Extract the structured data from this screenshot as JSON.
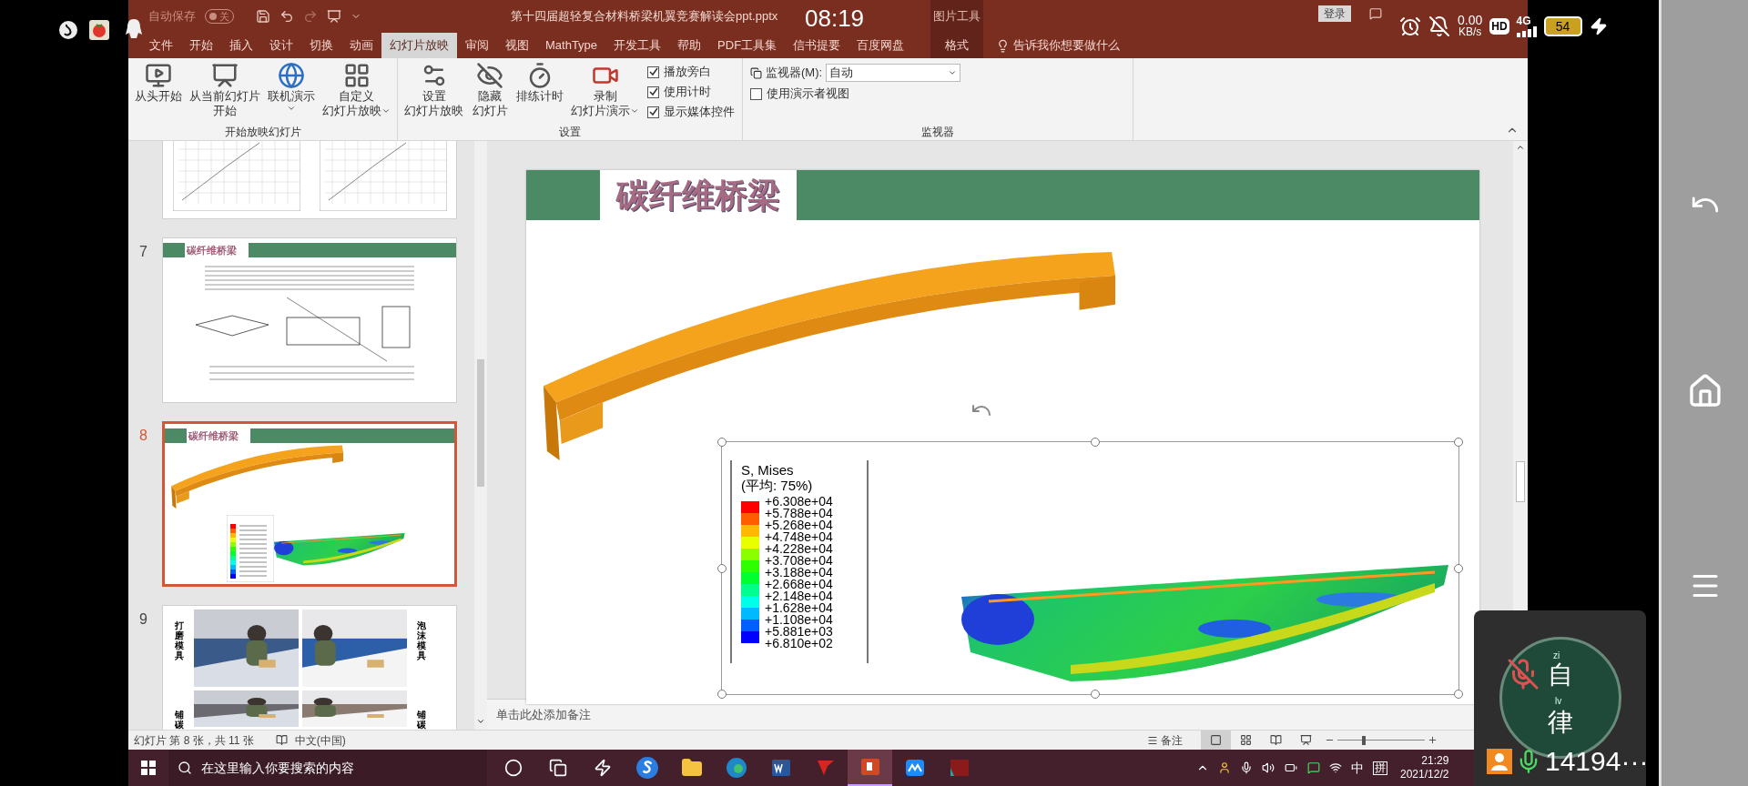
{
  "status_overlay": {
    "time": "08:19",
    "speed": "0.00",
    "speed_unit": "KB/s",
    "hd": "HD",
    "network": "4G",
    "battery": "54"
  },
  "title_bar": {
    "autosave": {
      "label": "自动保存",
      "toggle": "关",
      "on": false
    },
    "title": "第十四届超轻复合材料桥梁机翼竞赛解读会ppt.pptx",
    "context_group": "图片工具",
    "sign_in": "登录"
  },
  "tabs": [
    {
      "label": "文件",
      "selected": false
    },
    {
      "label": "开始",
      "selected": false
    },
    {
      "label": "插入",
      "selected": false
    },
    {
      "label": "设计",
      "selected": false
    },
    {
      "label": "切换",
      "selected": false
    },
    {
      "label": "动画",
      "selected": false
    },
    {
      "label": "幻灯片放映",
      "selected": true
    },
    {
      "label": "审阅",
      "selected": false
    },
    {
      "label": "视图",
      "selected": false
    },
    {
      "label": "MathType",
      "selected": false
    },
    {
      "label": "开发工具",
      "selected": false
    },
    {
      "label": "帮助",
      "selected": false
    },
    {
      "label": "PDF工具集",
      "selected": false
    },
    {
      "label": "信书提要",
      "selected": false
    },
    {
      "label": "百度网盘",
      "selected": false
    }
  ],
  "context_tab": {
    "label": "格式",
    "selected": false
  },
  "tell_me": "告诉我你想要做什么",
  "ribbon": {
    "groups": [
      {
        "label": "开始放映幻灯片",
        "buttons": [
          {
            "lines": [
              "从头开始"
            ],
            "dropdown": false
          },
          {
            "lines": [
              "从当前幻灯片",
              "开始"
            ],
            "dropdown": false
          },
          {
            "lines": [
              "联机演示"
            ],
            "dropdown": true
          },
          {
            "lines": [
              "自定义",
              "幻灯片放映"
            ],
            "dropdown": true
          }
        ]
      },
      {
        "label": "设置",
        "buttons": [
          {
            "lines": [
              "设置",
              "幻灯片放映"
            ],
            "dropdown": false
          },
          {
            "lines": [
              "隐藏",
              "幻灯片"
            ],
            "dropdown": false
          },
          {
            "lines": [
              "排练计时"
            ],
            "dropdown": false
          },
          {
            "lines": [
              "录制",
              "幻灯片演示"
            ],
            "dropdown": true
          }
        ],
        "checkboxes": [
          {
            "label": "播放旁白",
            "checked": true
          },
          {
            "label": "使用计时",
            "checked": true
          },
          {
            "label": "显示媒体控件",
            "checked": true
          }
        ]
      },
      {
        "label": "监视器",
        "monitor": {
          "label": "监视器(M):",
          "value": "自动"
        },
        "checkboxes": [
          {
            "label": "使用演示者视图",
            "checked": false
          }
        ]
      }
    ]
  },
  "thumbnails": [
    {
      "kind": "charts",
      "selected": false
    },
    {
      "number": "7",
      "kind": "text",
      "title": "碳纤维桥梁",
      "selected": false
    },
    {
      "number": "8",
      "kind": "stress",
      "title": "碳纤维桥梁",
      "selected": true
    },
    {
      "number": "9",
      "kind": "photos",
      "labels": [
        "打磨模具",
        "泡沫模具",
        "铺碳",
        "铺碳"
      ],
      "selected": false
    }
  ],
  "slide": {
    "title": "碳纤维桥梁",
    "legend": {
      "title": "S, Mises",
      "subtitle": "(平均: 75%)",
      "values": [
        "+6.308e+04",
        "+5.788e+04",
        "+5.268e+04",
        "+4.748e+04",
        "+4.228e+04",
        "+3.708e+04",
        "+3.188e+04",
        "+2.668e+04",
        "+2.148e+04",
        "+1.628e+04",
        "+1.108e+04",
        "+5.881e+03",
        "+6.810e+02"
      ],
      "bands": [
        {
          "color": "#ff0000"
        },
        {
          "color": "#ff5d00"
        },
        {
          "color": "#ffb900"
        },
        {
          "color": "#e8ff00"
        },
        {
          "color": "#8bff00"
        },
        {
          "color": "#2eff00"
        },
        {
          "color": "#00ff2e"
        },
        {
          "color": "#00ff8b"
        },
        {
          "color": "#00ffe8"
        },
        {
          "color": "#00b9ff"
        },
        {
          "color": "#005dff"
        },
        {
          "color": "#0000ff"
        }
      ]
    }
  },
  "notes_placeholder": "单击此处添加备注",
  "status_bar": {
    "slide_info": "幻灯片 第 8 张，共 11 张",
    "language": "中文(中国)",
    "notes": "备注",
    "views": [
      {
        "selected": true
      },
      {
        "selected": false
      },
      {
        "selected": false
      },
      {
        "selected": false
      }
    ],
    "zoom": {
      "level": 0.3
    }
  },
  "taskbar": {
    "search_placeholder": "在这里输入你要搜索的内容",
    "apps": [
      {
        "selected": false
      },
      {
        "selected": false
      },
      {
        "selected": false
      },
      {
        "selected": false
      },
      {
        "selected": false
      },
      {
        "selected": false
      },
      {
        "selected": false
      },
      {
        "selected": false
      },
      {
        "selected": true
      },
      {
        "selected": false
      },
      {
        "selected": false
      }
    ],
    "ime_lang": "中",
    "ime_mode": "拼",
    "time": "21:29",
    "date": "2021/12/2"
  },
  "floating_widget": {
    "top_small": "zi",
    "top_char": "自",
    "bottom_small": "lv",
    "bottom_char": "律",
    "count": "14194···"
  }
}
